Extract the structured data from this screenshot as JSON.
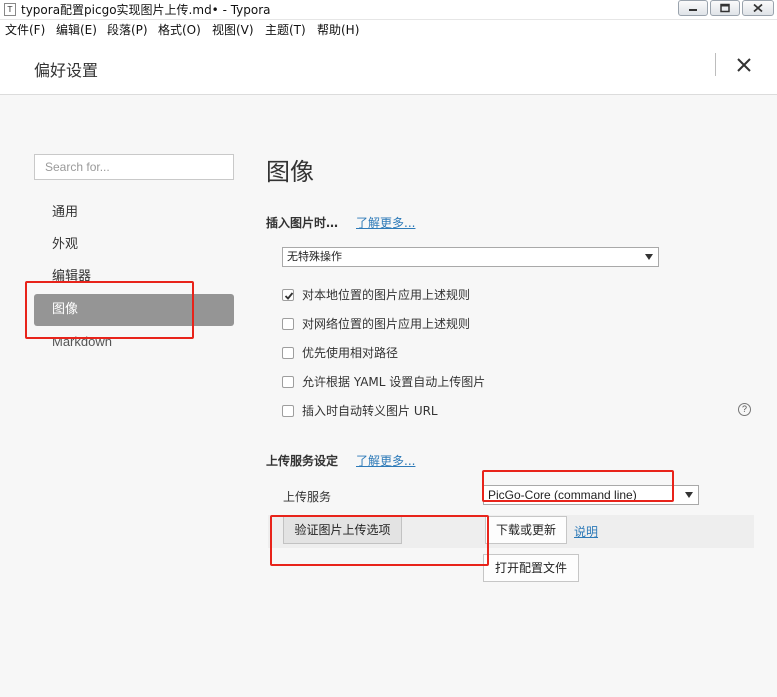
{
  "window": {
    "title": "typora配置picgo实现图片上传.md• - Typora",
    "app_icon_glyph": "T"
  },
  "menubar": [
    "文件(F)",
    "编辑(E)",
    "段落(P)",
    "格式(O)",
    "视图(V)",
    "主题(T)",
    "帮助(H)"
  ],
  "preferences": {
    "title": "偏好设置"
  },
  "sidebar": {
    "search_placeholder": "Search for...",
    "items": [
      {
        "label": "通用"
      },
      {
        "label": "外观"
      },
      {
        "label": "编辑器"
      },
      {
        "label": "图像",
        "active": true
      },
      {
        "label": "Markdown"
      }
    ]
  },
  "main": {
    "heading": "图像",
    "insert_image": {
      "label": "插入图片时…",
      "learn_more": "了解更多...",
      "dropdown_value": "无特殊操作",
      "options": [
        {
          "label": "对本地位置的图片应用上述规则",
          "checked": true
        },
        {
          "label": "对网络位置的图片应用上述规则",
          "checked": false
        },
        {
          "label": "优先使用相对路径",
          "checked": false
        },
        {
          "label": "允许根据 YAML 设置自动上传图片",
          "checked": false
        },
        {
          "label": "插入时自动转义图片 URL",
          "checked": false
        }
      ],
      "help_glyph": "?"
    },
    "upload": {
      "label": "上传服务设定",
      "learn_more": "了解更多...",
      "service_label": "上传服务",
      "service_value": "PicGo-Core (command line)",
      "validate_button": "验证图片上传选项",
      "download_button": "下载或更新",
      "explain_link": "说明",
      "open_config_button": "打开配置文件"
    }
  },
  "colors": {
    "annotation_red": "#e8231a",
    "link_blue": "#2d7ab8",
    "active_item": "#959595"
  }
}
